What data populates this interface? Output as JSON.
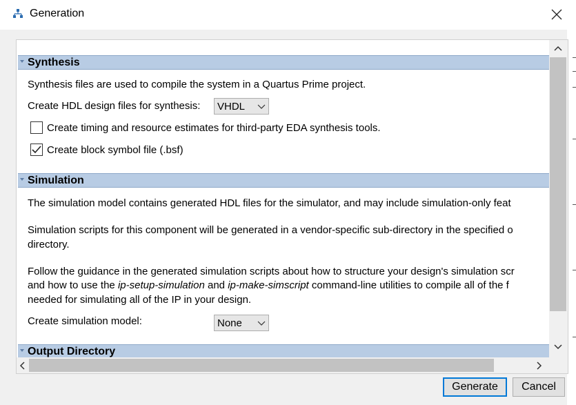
{
  "window": {
    "title": "Generation",
    "icon": "network-icon",
    "close_icon": "close-icon"
  },
  "synthesis": {
    "header": "Synthesis",
    "description": "Synthesis files are used to compile the system in a Quartus Prime project.",
    "hdl_label": "Create HDL design files for synthesis:",
    "hdl_value": "VHDL",
    "timing_checkbox_label": "Create timing and resource estimates for third-party EDA synthesis tools.",
    "timing_checked": false,
    "bsf_checkbox_label": "Create block symbol file (.bsf)",
    "bsf_checked": true
  },
  "simulation": {
    "header": "Simulation",
    "para1": "The simulation model contains generated HDL files for the simulator, and may include simulation-only feat",
    "para2_line1": "Simulation scripts for this component will be generated in a vendor-specific sub-directory in the specified o",
    "para2_line2": "directory.",
    "para3_line1": "Follow the guidance in the generated simulation scripts about how to structure your design's simulation scr",
    "para3_line2_pre": "and how to use the ",
    "para3_line2_cmd1": "ip-setup-simulation",
    "para3_line2_mid": " and ",
    "para3_line2_cmd2": "ip-make-simscript",
    "para3_line2_post": " command-line utilities to compile all of the f",
    "para3_line3": "needed for simulating all of the IP in your design.",
    "model_label": "Create simulation model:",
    "model_value": "None"
  },
  "output_directory": {
    "header": "Output Directory"
  },
  "buttons": {
    "generate": "Generate",
    "cancel": "Cancel"
  },
  "colors": {
    "section_header": "#b8cce4",
    "primary_border": "#0078d7",
    "scroll_thumb": "#c2c2c2"
  }
}
